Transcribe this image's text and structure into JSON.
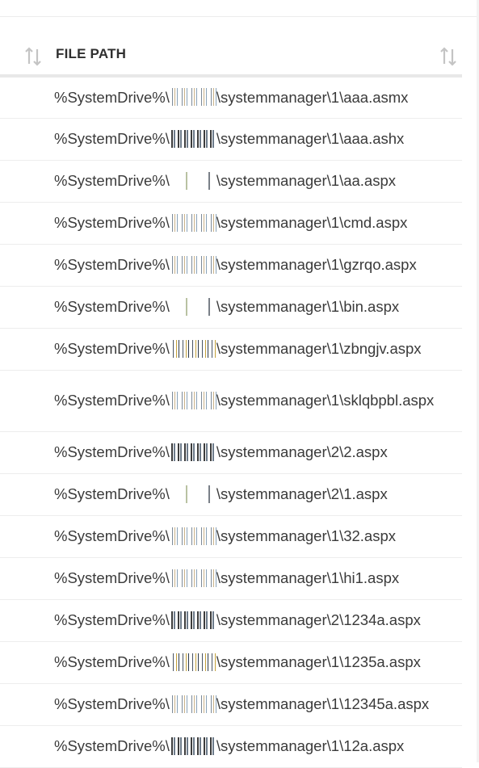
{
  "header": {
    "column_title": "FILE PATH",
    "sort_icons": [
      "sort-arrows-icon",
      "sort-arrows-icon"
    ]
  },
  "rows": [
    {
      "prefix": "%SystemDrive%\\",
      "suffix": "\\systemmanager\\1\\aaa.asmx"
    },
    {
      "prefix": "%SystemDrive%\\",
      "suffix": "\\systemmanager\\1\\aaa.ashx"
    },
    {
      "prefix": "%SystemDrive%\\",
      "suffix": "\\systemmanager\\1\\aa.aspx"
    },
    {
      "prefix": "%SystemDrive%\\",
      "suffix": "\\systemmanager\\1\\cmd.aspx"
    },
    {
      "prefix": "%SystemDrive%\\",
      "suffix": "\\systemmanager\\1\\gzrqo.aspx"
    },
    {
      "prefix": "%SystemDrive%\\",
      "suffix": "\\systemmanager\\1\\bin.aspx"
    },
    {
      "prefix": "%SystemDrive%\\",
      "suffix": "\\systemmanager\\1\\zbngjv.aspx"
    },
    {
      "prefix": "%SystemDrive%\\",
      "suffix": "\\systemmanager\\1\\sklqbpbl.aspx"
    },
    {
      "prefix": "%SystemDrive%\\",
      "suffix": "\\systemmanager\\2\\2.aspx"
    },
    {
      "prefix": "%SystemDrive%\\",
      "suffix": "\\systemmanager\\2\\1.aspx"
    },
    {
      "prefix": "%SystemDrive%\\",
      "suffix": "\\systemmanager\\1\\32.aspx"
    },
    {
      "prefix": "%SystemDrive%\\",
      "suffix": "\\systemmanager\\1\\hi1.aspx"
    },
    {
      "prefix": "%SystemDrive%\\",
      "suffix": "\\systemmanager\\2\\1234a.aspx"
    },
    {
      "prefix": "%SystemDrive%\\",
      "suffix": "\\systemmanager\\1\\1235a.aspx"
    },
    {
      "prefix": "%SystemDrive%\\",
      "suffix": "\\systemmanager\\1\\12345a.aspx"
    },
    {
      "prefix": "%SystemDrive%\\",
      "suffix": "\\systemmanager\\1\\12a.aspx"
    }
  ]
}
